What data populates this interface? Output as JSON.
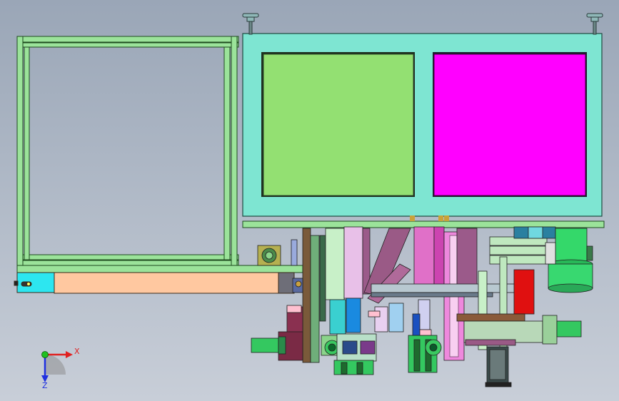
{
  "viewport": {
    "view": "3D CAD viewport",
    "colors": {
      "background_top": "#9aa6b7",
      "background_bottom": "#c8ced8",
      "frame_green": "#9be39a",
      "frame_outline": "#1e4a1e",
      "cabinet_cyan": "#7ee5d2",
      "panel_green": "#93e072",
      "panel_magenta": "#ff00ff",
      "conveyor_orange": "#ffc8a0",
      "deep_red": "#e01010",
      "purple": "#9a5a86"
    }
  },
  "axis_triad": {
    "x_label": "X",
    "z_label": "Z",
    "x_color": "#e02020",
    "y_color": "#20c020",
    "z_color": "#2030e0"
  }
}
